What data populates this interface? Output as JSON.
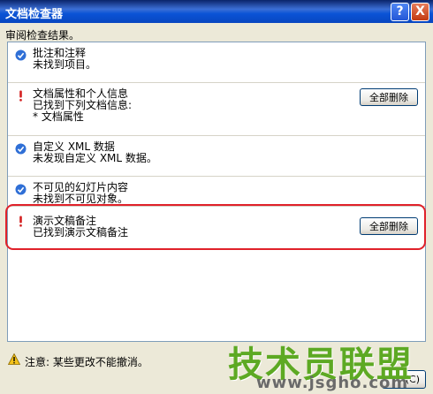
{
  "window": {
    "title": "文档检查器",
    "help_label": "?",
    "close_label": "X"
  },
  "review_label": "审阅检查结果。",
  "sections": [
    {
      "status": "ok",
      "title": "批注和注释",
      "details": [
        "未找到项目。"
      ]
    },
    {
      "status": "found",
      "title": "文档属性和个人信息",
      "details": [
        "已找到下列文档信息:",
        "* 文档属性"
      ],
      "button_label": "全部删除"
    },
    {
      "status": "ok",
      "title": "自定义 XML 数据",
      "details": [
        "未发现自定义 XML 数据。"
      ]
    },
    {
      "status": "ok",
      "title": "不可见的幻灯片内容",
      "details": [
        "未找到不可见对象。"
      ]
    },
    {
      "status": "found",
      "title": "演示文稿备注",
      "details": [
        "已找到演示文稿备注"
      ],
      "button_label": "全部删除"
    }
  ],
  "note": "注意: 某些更改不能撤消。",
  "close_button_label": "(C)",
  "watermark": {
    "text": "技术员联盟",
    "url": "www.jsgho.com"
  },
  "colors": {
    "highlight": "#e0212a",
    "ok_icon": "#2f6fd6",
    "found_icon": "#d42020",
    "watermark": "#5da923"
  }
}
